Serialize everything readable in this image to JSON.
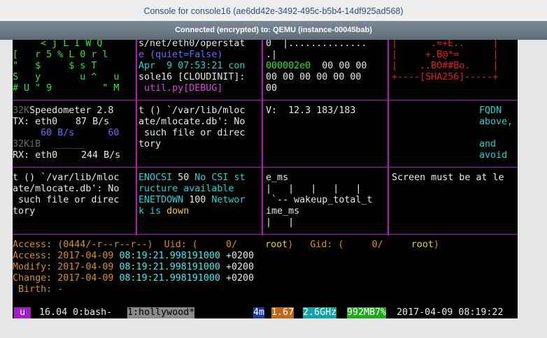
{
  "window": {
    "title": "Console for console16 (ae6dd42e-3492-495c-b5b4-14df925ad568)",
    "connection": "Connected (encrypted) to: QEMU (instance-00045bab)"
  },
  "terminal": {
    "pane_top_left_lines": [
      "     < j L I W Q",
      "[   r 5 % L 0 r l",
      "\"   $     $ s T",
      "S   y       u ^   u",
      "# U \" 9         \" M"
    ],
    "pane_top_mid_lines": [
      "s/net/eth0/operstat",
      "e (quiet=False)",
      "Apr  9 07:53:21 con",
      "sole16 [CLOUDINIT]:",
      " util.py[DEBUG]"
    ],
    "pane_hex": {
      "line1": "0  |..............",
      "line2": ".|",
      "line3_addr": "000002e0",
      "line3_bytes": "  00 00 00",
      "line4": "00 00 00 00 00 00",
      "line5": "00"
    },
    "pane_sha": {
      "line1": "|      .=+E..     |",
      "line2": "|     +.B@*=      |",
      "line3": "|    ..BO##Bo.    |",
      "line4": "+----[SHA256]-----+"
    },
    "speedometer": {
      "tx_scale": "32K",
      "title": "Speedometer 2.8",
      "tx_label": "TX: eth0",
      "tx_value": "87 B/s",
      "tx_rate_line": "     60 B/s      60",
      "rx_scale": "32KiB",
      "rx_bar": "______",
      "rx_label": "RX: eth0",
      "rx_value": "244 B/s"
    },
    "pane_mlocate_1": [
      "t () `/var/lib/mloc",
      "ate/mlocate.db': No",
      " such file or direc",
      "tory"
    ],
    "pane_stats": "V:  12.3 183/183",
    "pane_fqdn": [
      "FQDN",
      "above,",
      "",
      "and",
      "avoid"
    ],
    "pane_mlocate_2": [
      "t () `/var/lib/mloc",
      "ate/mlocate.db': No",
      " such file or direc",
      "tory"
    ],
    "pane_errno": {
      "l1a": "ENOCSI",
      "l1b": " 50 ",
      "l1c": "No CSI st",
      "l2": "ructure available",
      "l3a": "ENETDOWN",
      "l3b": " 100 ",
      "l3c": "Networ",
      "l4a": "k is ",
      "l4b": "down"
    },
    "pane_ms": [
      "e_ms",
      "|   |   |   |   |",
      " `-- wakeup_total_t",
      "ime_ms",
      "|   |"
    ],
    "pane_screen": "Screen must be at le",
    "stat": {
      "access_perm_label": "Access: ",
      "access_perm_value": "(0444/-r--r--r--)",
      "uid_label": "  Uid: (     0/     ",
      "uid_name": "root",
      "gid_label": ")   Gid: (     0/     ",
      "gid_name": "root",
      "gid_close": ")",
      "access_label": "Access: ",
      "access_date": "2017-04-09 ",
      "access_time": "08:19:21.998191000",
      "access_tz": " +0200",
      "modify_label": "Modify: ",
      "modify_date": "2017-04-09 ",
      "modify_time": "08:19:21.998191000",
      "modify_tz": " +0200",
      "change_label": "Change: ",
      "change_date": "2017-04-09 ",
      "change_time": "08:19:21.998191000",
      "change_tz": " +0200",
      "birth": " Birth: -"
    },
    "tmux": {
      "session": " u ",
      "version": " 16.04 ",
      "window0": "0:bash- ",
      "window1": "1:hollywood*",
      "mem": "4m",
      "load": "1.67",
      "cpu": "2.6GHz",
      "ram": "992MB7%",
      "datetime": " 2017-04-09 08:19:22"
    }
  }
}
